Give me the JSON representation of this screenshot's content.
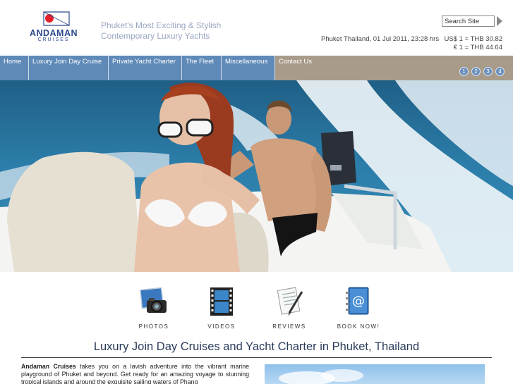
{
  "brand": {
    "name": "ANDAMAN",
    "sub": "CRUISES",
    "tagline_1": "Phuket's Most Exciting & Stylish",
    "tagline_2": "Contemporary Luxury Yachts",
    "colors": {
      "brand_blue": "#2b4a8c",
      "flag_red": "#e4202a",
      "nav_blue": "#5f8ab8",
      "nav_tan": "#a99b8a"
    }
  },
  "search": {
    "value": "Search Site"
  },
  "status": {
    "datetime": "Phuket Thailand, 01 Jul 2011, 23:28 hrs",
    "fx_usd": "US$ 1 = THB 30.82",
    "fx_eur": "€ 1 = THB 44.64"
  },
  "nav": {
    "items": [
      {
        "label": "Home"
      },
      {
        "label": "Luxury Join Day Cruise"
      },
      {
        "label": "Private Yacht Charter"
      },
      {
        "label": "The Fleet"
      },
      {
        "label": "Miscellaneous"
      },
      {
        "label": "Contact Us"
      }
    ]
  },
  "slider": {
    "pages": [
      "1",
      "2",
      "3",
      "4"
    ]
  },
  "features": [
    {
      "label": "PHOTOS",
      "icon": "camera-icon"
    },
    {
      "label": "VIDEOS",
      "icon": "film-icon"
    },
    {
      "label": "REVIEWS",
      "icon": "document-pen-icon"
    },
    {
      "label": "BOOK NOW!",
      "icon": "address-book-icon"
    }
  ],
  "content": {
    "headline": "Luxury Join Day Cruises and Yacht Charter in Phuket, Thailand",
    "intro_bold": "Andaman Cruises",
    "intro_rest": " takes you on a lavish adventure into the vibrant marine playground of Phuket and beyond. Get ready for an amazing voyage to stunning tropical islands and around the exquisite sailing waters of Phang"
  }
}
